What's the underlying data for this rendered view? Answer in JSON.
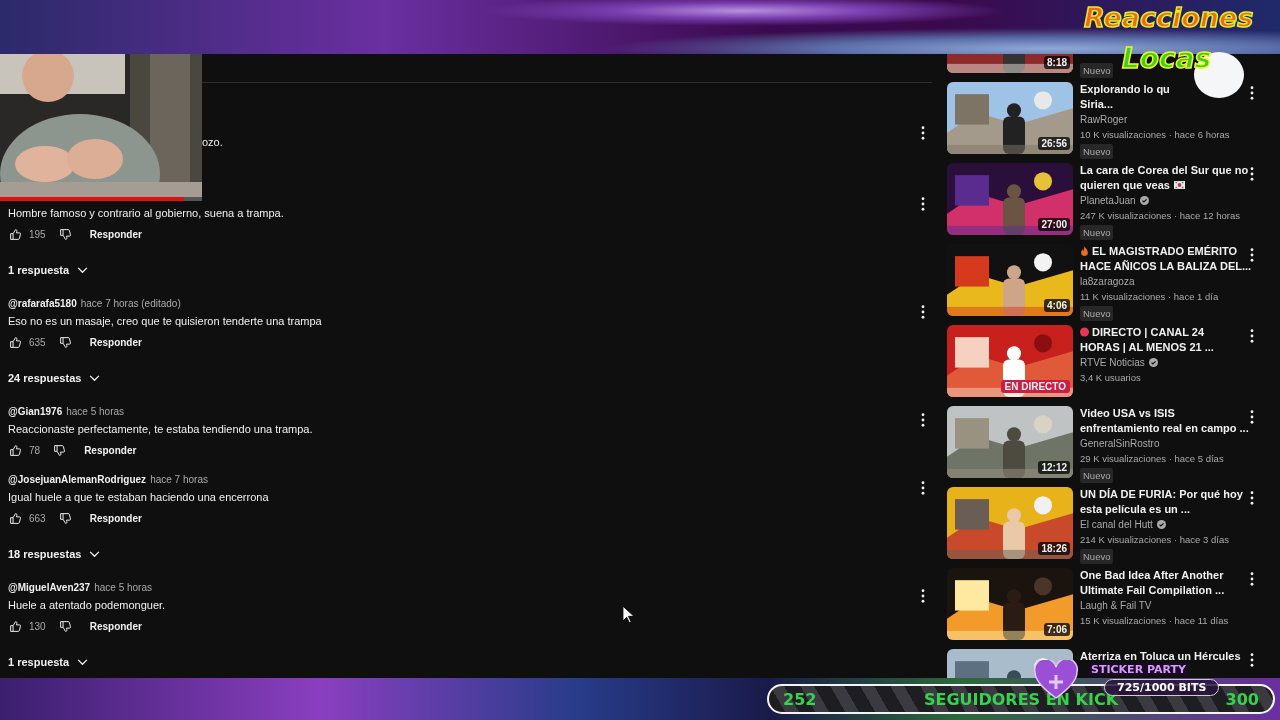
{
  "webcam": {
    "kind": "picture",
    "progress": {
      "level": 0.91
    }
  },
  "logo": {
    "line1": "Reacciones",
    "line2": "Locas"
  },
  "comments": [
    {
      "kind": "partial",
      "text": "ozo."
    },
    {
      "kind": "full",
      "text": "Hombre famoso y contrario al gobierno, suena a trampa.",
      "likes": "195",
      "reply": "Responder",
      "replies": "1 respuesta"
    },
    {
      "kind": "full",
      "author": "@rafarafa5180",
      "time": "hace 7 horas (editado)",
      "text": "Eso no es un masaje, creo que te quisieron tenderte una trampa",
      "likes": "635",
      "reply": "Responder",
      "replies": "24 respuestas"
    },
    {
      "kind": "full",
      "author": "@Gian1976",
      "time": "hace 5 horas",
      "text": "Reaccionaste perfectamente, te estaba tendiendo una trampa.",
      "likes": "78",
      "reply": "Responder"
    },
    {
      "kind": "full",
      "author": "@JosejuanAlemanRodriguez",
      "time": "hace 7 horas",
      "text": "Igual huele a que te estaban haciendo una encerrona",
      "likes": "663",
      "reply": "Responder",
      "replies": "18 respuestas"
    },
    {
      "kind": "full",
      "author": "@MiguelAven237",
      "time": "hace 5 horas",
      "text": "Huele a atentado podemonguer.",
      "likes": "130",
      "reply": "Responder",
      "replies": "1 respuesta"
    }
  ],
  "videos": [
    {
      "kind": "video",
      "duration": "8:18",
      "badge": "Nuevo"
    },
    {
      "kind": "video",
      "title": "Explorando lo qu\nSiria...",
      "channel": "RawRoger",
      "verified": false,
      "meta": "10 K visualizaciones · hace 6 horas",
      "duration": "26:56",
      "badge": "Nuevo"
    },
    {
      "kind": "flagged",
      "title": "La cara de Corea del Sur que no\nquieren que veas",
      "channel": "PlanetaJuan",
      "verified": true,
      "meta": "247 K visualizaciones · hace 12 horas",
      "duration": "27:00",
      "badge": "Nuevo"
    },
    {
      "kind": "trending",
      "title": "EL MAGISTRADO EMÉRITO\nHACE AÑICOS LA BALIZA DEL...",
      "channel": "la8zaragoza",
      "verified": false,
      "meta": "11 K visualizaciones · hace 1 día",
      "duration": "4:06",
      "badge": "Nuevo"
    },
    {
      "kind": "live",
      "title": "DIRECTO | CANAL 24\nHORAS | AL MENOS 21 ...",
      "channel": "RTVE Noticias",
      "verified": true,
      "meta": "3,4 K usuarios",
      "live_label": "EN DIRECTO"
    },
    {
      "kind": "video",
      "title": "Video USA vs ISIS\nenfrentamiento real en campo ...",
      "channel": "GeneralSinRostro",
      "verified": false,
      "meta": "29 K visualizaciones · hace 5 días",
      "duration": "12:12",
      "badge": "Nuevo"
    },
    {
      "kind": "video",
      "title": "UN DÍA DE FURIA: Por qué hoy\nesta película es un ...",
      "channel": "El canal del Hutt",
      "verified": true,
      "meta": "214 K visualizaciones · hace 3 días",
      "duration": "18:26",
      "badge": "Nuevo"
    },
    {
      "kind": "video",
      "title": "One Bad Idea After Another\nUltimate Fail Compilation ...",
      "channel": "Laugh & Fail TV",
      "verified": false,
      "meta": "15 K visualizaciones · hace 11 días",
      "duration": "7:06"
    },
    {
      "kind": "video",
      "title": "Aterriza en Toluca un Hércules"
    }
  ],
  "sticker": {
    "title": "STICKER PARTY",
    "progress": "725/1000 BITS"
  },
  "followers": {
    "current": "252",
    "label": "SEGUIDORES EN KICK",
    "target": "300"
  }
}
